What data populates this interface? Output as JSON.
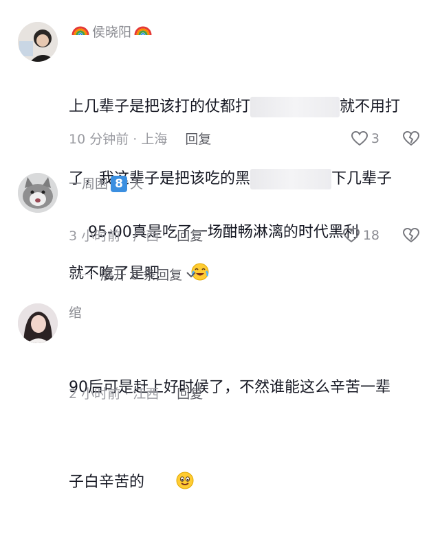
{
  "comments": [
    {
      "user": "侯晓阳",
      "text_a": "上几辈子是把该打的仗都打",
      "text_b": "就不用打",
      "text_c": "了，我这辈子是把该吃的黑",
      "text_d": "下几辈子",
      "text_e": "就不吃了是吧",
      "time_loc": "10 分钟前 · 上海",
      "reply": "回复",
      "likes": "3"
    },
    {
      "user_a": "一周困",
      "user_badge": "8",
      "user_b": "天",
      "text": "95-00真是吃了一场酣畅淋漓的时代黑利",
      "time_loc": "3 小时前 · 广西",
      "reply": "回复",
      "likes": "18"
    },
    {
      "user": "绾",
      "text_a": "90后可是赶上好时候了，不然谁能这么辛苦一辈",
      "text_b": "子白辛苦的",
      "time_loc": "2 小时前 · 江西",
      "reply": "回复"
    }
  ],
  "expand_label": "展开 8 条回复",
  "icons": {
    "like": "heart-outline-icon",
    "dislike": "broken-heart-icon",
    "emoji1": "crying-laughing-emoji",
    "emoji2": "smiling-emoji",
    "rainbow": "rainbow-emoji"
  }
}
